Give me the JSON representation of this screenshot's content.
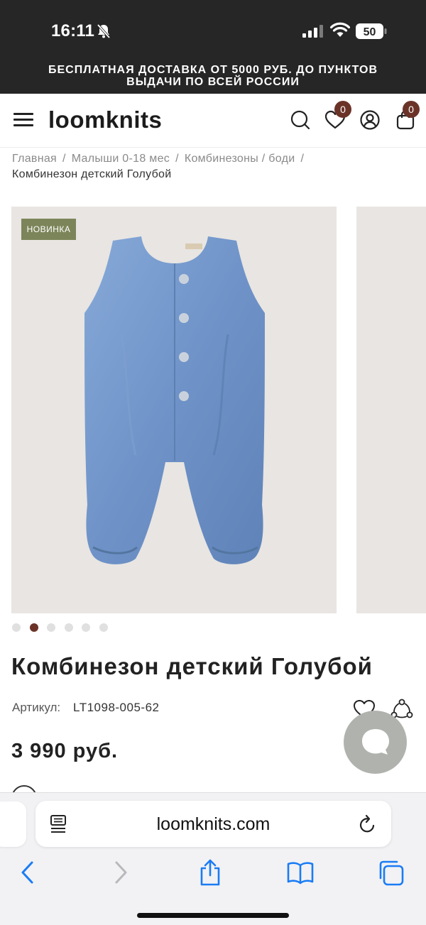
{
  "status_bar": {
    "time": "16:11",
    "battery": "50"
  },
  "promo": {
    "line1": "БЕСПЛАТНАЯ ДОСТАВКА ОТ 5000 РУБ. ДО ПУНКТОВ",
    "line2": "ВЫДАЧИ ПО ВСЕЙ РОССИИ"
  },
  "header": {
    "logo": "loomknits",
    "wishlist_count": "0",
    "cart_count": "0"
  },
  "breadcrumb": {
    "items": [
      "Главная",
      "Малыши 0-18 мес",
      "Комбинезоны / боди"
    ],
    "separator": "/",
    "current": "Комбинезон детский Голубой"
  },
  "gallery": {
    "badge": "НОВИНКА",
    "slide_count": 6,
    "active_index": 1
  },
  "product": {
    "title": "Комбинезон детский Голубой",
    "sku_label": "Артикул:",
    "sku": "LT1098-005-62",
    "price": "3 990 руб."
  },
  "browser": {
    "url": "loomknits.com"
  },
  "colors": {
    "accent": "#6b3328",
    "badge_green": "#7c8559",
    "dark_bar": "#262626",
    "safari_blue": "#1a7cf5"
  }
}
